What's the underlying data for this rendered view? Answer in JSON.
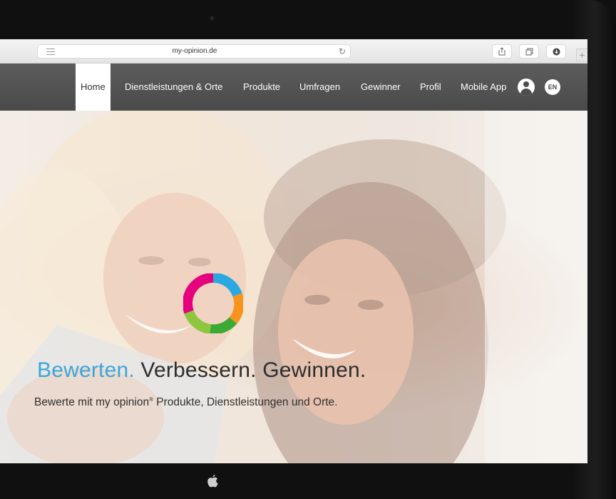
{
  "browser": {
    "url": "my-opinion.de",
    "reload_icon": "reload-icon",
    "share_icon": "share-icon",
    "tabs_icon": "tabs-icon",
    "downloads_icon": "downloads-icon",
    "new_tab_label": "+"
  },
  "nav": {
    "items": [
      {
        "label": "Home",
        "active": true
      },
      {
        "label": "Dienstleistungen & Orte"
      },
      {
        "label": "Produkte"
      },
      {
        "label": "Umfragen"
      },
      {
        "label": "Gewinner"
      },
      {
        "label": "Profil"
      },
      {
        "label": "Mobile App"
      }
    ],
    "account_icon": "user-icon",
    "language": "EN"
  },
  "hero": {
    "headline_accent": "Bewerten.",
    "headline_rest": "Verbessern. Gewinnen.",
    "subline_before": "Bewerte mit my opinion",
    "subline_mark": "®",
    "subline_after": " Produkte, Dienstleistungen und Orte.",
    "logo_icon": "ring-logo-icon",
    "logo_colors": [
      "#29a9e0",
      "#f7941d",
      "#3aaa35",
      "#8dc63f",
      "#e6007e"
    ]
  },
  "device": {
    "brand_icon": "apple-logo-icon"
  }
}
